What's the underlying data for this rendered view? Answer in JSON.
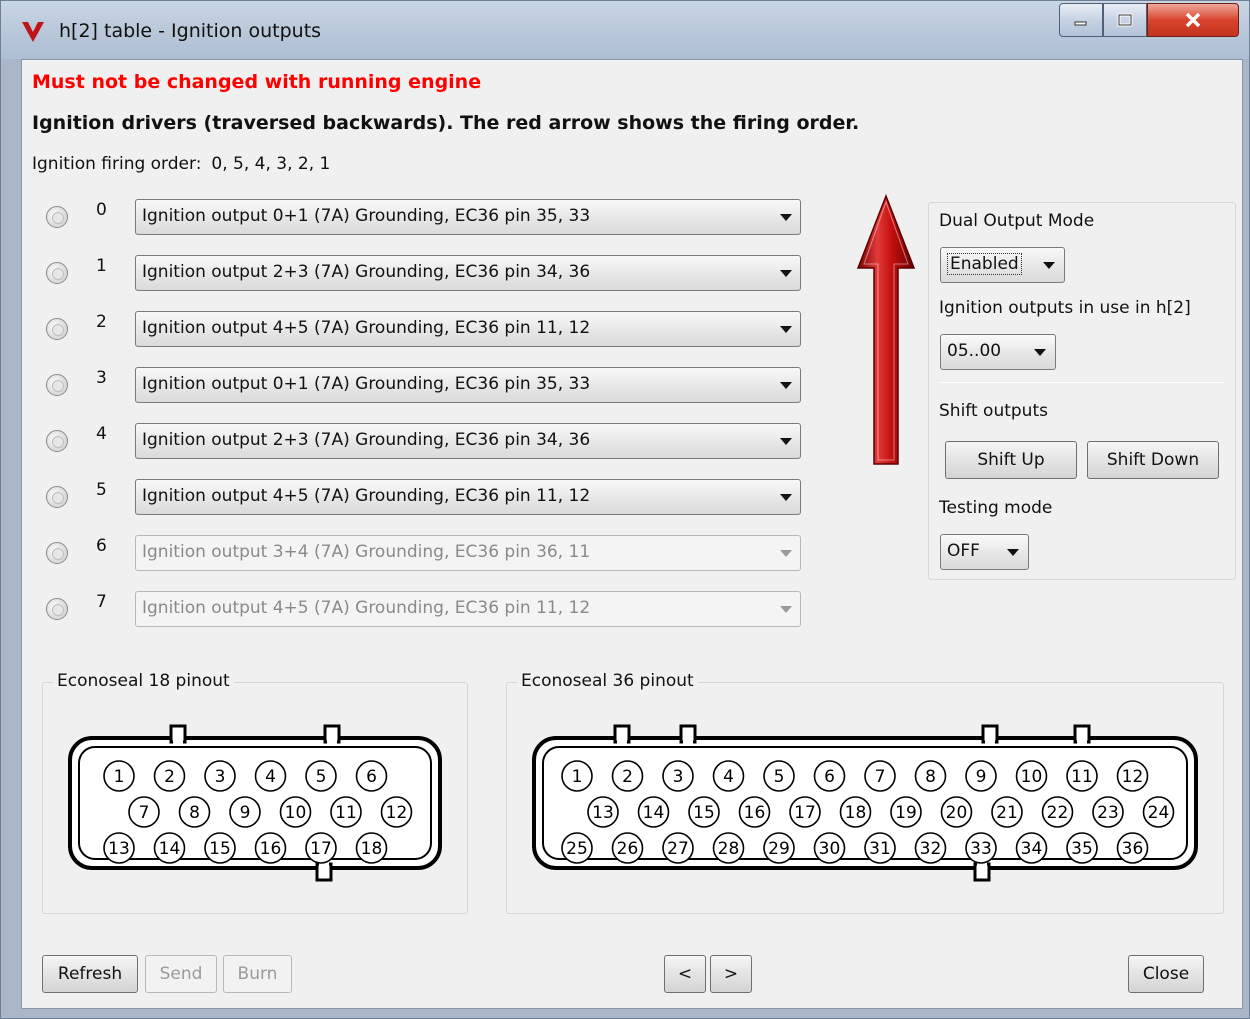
{
  "window": {
    "title": "h[2] table - Ignition outputs",
    "controls": {
      "minimize": "minimize",
      "maximize": "maximize",
      "close": "close"
    }
  },
  "warning": "Must not be changed with running engine",
  "subtitle": "Ignition drivers (traversed backwards). The red arrow shows the firing order.",
  "firing_order": {
    "label": "Ignition firing order:",
    "value": "0, 5, 4, 3, 2, 1"
  },
  "outputs": [
    {
      "index": "0",
      "value": "Ignition output 0+1 (7A) Grounding, EC36  pin 35, 33",
      "enabled": true
    },
    {
      "index": "1",
      "value": "Ignition output 2+3 (7A) Grounding, EC36  pin 34, 36",
      "enabled": true
    },
    {
      "index": "2",
      "value": "Ignition output 4+5 (7A) Grounding, EC36  pin 11, 12",
      "enabled": true
    },
    {
      "index": "3",
      "value": "Ignition output 0+1 (7A) Grounding, EC36  pin 35, 33",
      "enabled": true
    },
    {
      "index": "4",
      "value": "Ignition output 2+3 (7A) Grounding, EC36  pin 34, 36",
      "enabled": true
    },
    {
      "index": "5",
      "value": "Ignition output 4+5 (7A) Grounding, EC36  pin 11, 12",
      "enabled": true
    },
    {
      "index": "6",
      "value": "Ignition output 3+4 (7A) Grounding, EC36  pin 36, 11",
      "enabled": false
    },
    {
      "index": "7",
      "value": "Ignition output 4+5 (7A) Grounding, EC36  pin 11, 12",
      "enabled": false
    }
  ],
  "side_panel": {
    "dual_output_label": "Dual Output Mode",
    "dual_output_value": "Enabled",
    "outputs_in_use_label": "Ignition outputs in use in h[2]",
    "outputs_in_use_value": "05..00",
    "shift_label": "Shift outputs",
    "shift_up": "Shift Up",
    "shift_down": "Shift Down",
    "testing_label": "Testing mode",
    "testing_value": "OFF"
  },
  "econoseal18": {
    "title": "Econoseal 18 pinout",
    "rows": [
      [
        "1",
        "2",
        "3",
        "4",
        "5",
        "6"
      ],
      [
        "7",
        "8",
        "9",
        "10",
        "11",
        "12"
      ],
      [
        "13",
        "14",
        "15",
        "16",
        "17",
        "18"
      ]
    ]
  },
  "econoseal36": {
    "title": "Econoseal 36 pinout",
    "rows": [
      [
        "1",
        "2",
        "3",
        "4",
        "5",
        "6",
        "7",
        "8",
        "9",
        "10",
        "11",
        "12"
      ],
      [
        "13",
        "14",
        "15",
        "16",
        "17",
        "18",
        "19",
        "20",
        "21",
        "22",
        "23",
        "24"
      ],
      [
        "25",
        "26",
        "27",
        "28",
        "29",
        "30",
        "31",
        "32",
        "33",
        "34",
        "35",
        "36"
      ]
    ]
  },
  "footer": {
    "refresh": "Refresh",
    "send": "Send",
    "burn": "Burn",
    "prev": "<",
    "next": ">",
    "close": "Close"
  },
  "colors": {
    "warning": "#ff0000",
    "arrow": "#b30000",
    "titlebar": "#b7c6d8",
    "client": "#f0f0f0"
  }
}
